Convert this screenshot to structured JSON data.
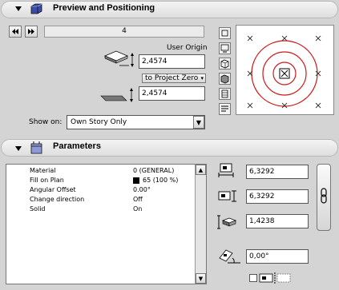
{
  "preview": {
    "title": "Preview and Positioning",
    "nav_value": "4",
    "user_origin_label": "User Origin",
    "user_origin_value": "2,4574",
    "project_zero_label": "to Project Zero",
    "project_zero_value": "2,4574",
    "show_on_label": "Show on:",
    "show_on_value": "Own Story Only"
  },
  "parameters": {
    "title": "Parameters",
    "rows": [
      {
        "name": "Material",
        "value": "0 (GENERAL)"
      },
      {
        "name": "Fill on Plan",
        "value": "65 (100 %)"
      },
      {
        "name": "Angular Offset",
        "value": "0.00°"
      },
      {
        "name": "Change direction",
        "value": "Off"
      },
      {
        "name": "Solid",
        "value": "On"
      }
    ],
    "width_value": "6,3292",
    "depth_value": "6,3292",
    "height_value": "1,4238",
    "angle_value": "0,00°"
  },
  "colors": {
    "accent_red": "#d01818"
  }
}
